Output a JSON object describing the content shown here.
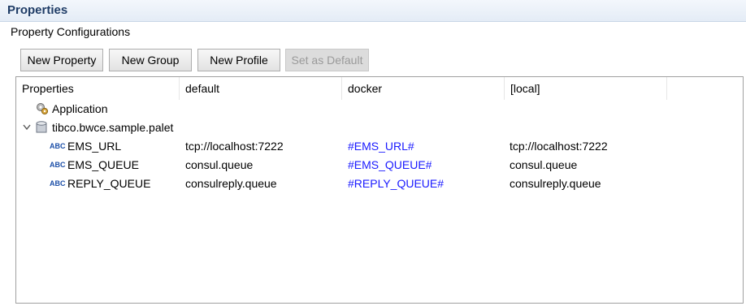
{
  "header": {
    "title": "Properties"
  },
  "section_label": "Property Configurations",
  "buttons": {
    "new_property": "New Property",
    "new_group": "New Group",
    "new_profile": "New Profile",
    "set_default": "Set as Default"
  },
  "columns": [
    "Properties",
    "default",
    "docker",
    "[local]"
  ],
  "tree": {
    "application": {
      "label": "Application"
    },
    "group": {
      "label": "tibco.bwce.sample.palet"
    },
    "rows": [
      {
        "name": "EMS_URL",
        "default": "tcp://localhost:7222",
        "docker": "#EMS_URL#",
        "local": "tcp://localhost:7222"
      },
      {
        "name": "EMS_QUEUE",
        "default": "consul.queue",
        "docker": "#EMS_QUEUE#",
        "local": "consul.queue"
      },
      {
        "name": "REPLY_QUEUE",
        "default": "consulreply.queue",
        "docker": "#REPLY_QUEUE#",
        "local": "consulreply.queue"
      }
    ]
  },
  "icons": {
    "abc_icon_text": "ABC",
    "accent": "#1a1aff",
    "header_text": "#1f3c66"
  }
}
